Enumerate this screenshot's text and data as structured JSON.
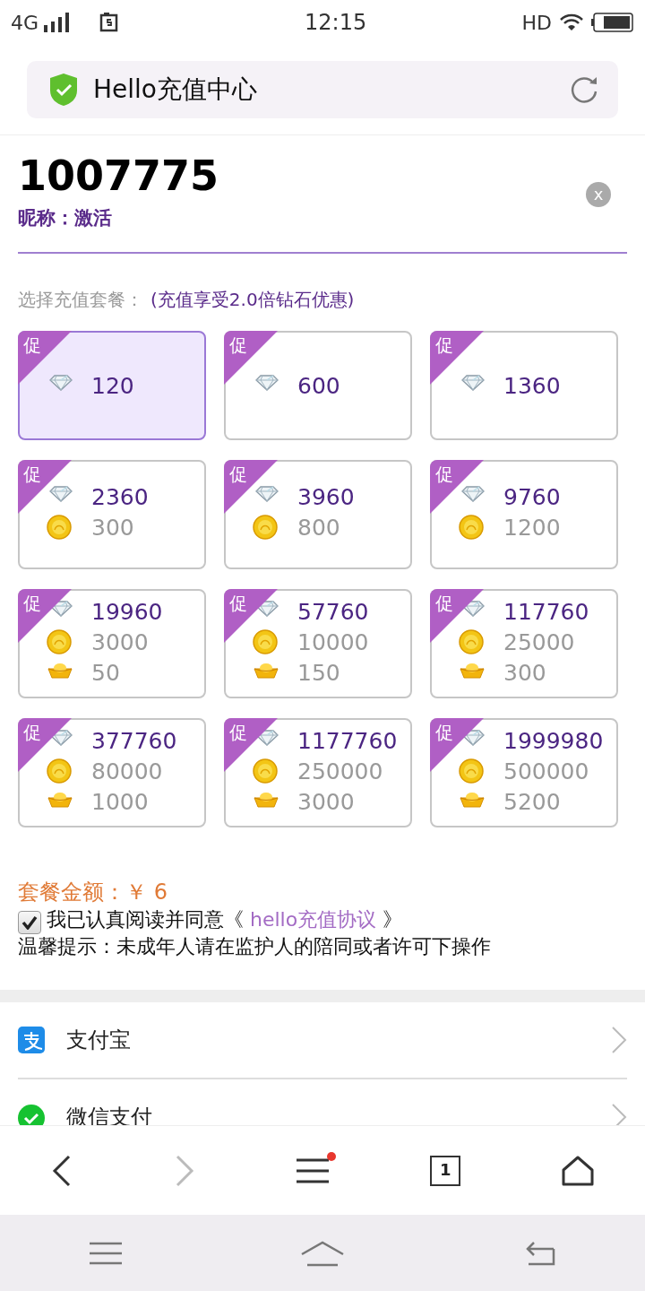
{
  "status_bar": {
    "network": "4G",
    "time": "12:15",
    "hd": "HD"
  },
  "address_bar": {
    "title": "Hello充值中心"
  },
  "account": {
    "id": "1007775",
    "nickname": "昵称：激活",
    "clear": "x"
  },
  "packages": {
    "label": "选择充值套餐：",
    "promo_note": "(充值享受2.0倍钻石优惠)",
    "items": [
      {
        "badge": "促",
        "diamonds": "120",
        "selected": true
      },
      {
        "badge": "促",
        "diamonds": "600",
        "selected": false
      },
      {
        "badge": "促",
        "diamonds": "1360",
        "selected": false
      },
      {
        "badge": "促",
        "diamonds": "2360",
        "coins": "300",
        "selected": false
      },
      {
        "badge": "促",
        "diamonds": "3960",
        "coins": "800",
        "selected": false
      },
      {
        "badge": "促",
        "diamonds": "9760",
        "coins": "1200",
        "selected": false
      },
      {
        "badge": "促",
        "diamonds": "19960",
        "coins": "3000",
        "ingots": "50",
        "selected": false
      },
      {
        "badge": "促",
        "diamonds": "57760",
        "coins": "10000",
        "ingots": "150",
        "selected": false
      },
      {
        "badge": "促",
        "diamonds": "117760",
        "coins": "25000",
        "ingots": "300",
        "selected": false
      },
      {
        "badge": "促",
        "diamonds": "377760",
        "coins": "80000",
        "ingots": "1000",
        "selected": false
      },
      {
        "badge": "促",
        "diamonds": "1177760",
        "coins": "250000",
        "ingots": "3000",
        "selected": false
      },
      {
        "badge": "促",
        "diamonds": "1999980",
        "coins": "500000",
        "ingots": "5200",
        "selected": false
      }
    ]
  },
  "amount": {
    "label": "套餐金额：",
    "value": "￥ 6"
  },
  "agreement": {
    "checked": true,
    "text": "我已认真阅读并同意《",
    "link": "hello充值协议",
    "close": "》"
  },
  "notice": "温馨提示：未成年人请在监护人的陪同或者许可下操作",
  "payment_methods": [
    {
      "kind": "alipay",
      "label": "支付宝"
    },
    {
      "kind": "wechat",
      "label": "微信支付"
    }
  ],
  "browser_bar": {
    "back_disabled": false,
    "forward_disabled": true,
    "menu_dot": true,
    "tab_count": "1"
  }
}
